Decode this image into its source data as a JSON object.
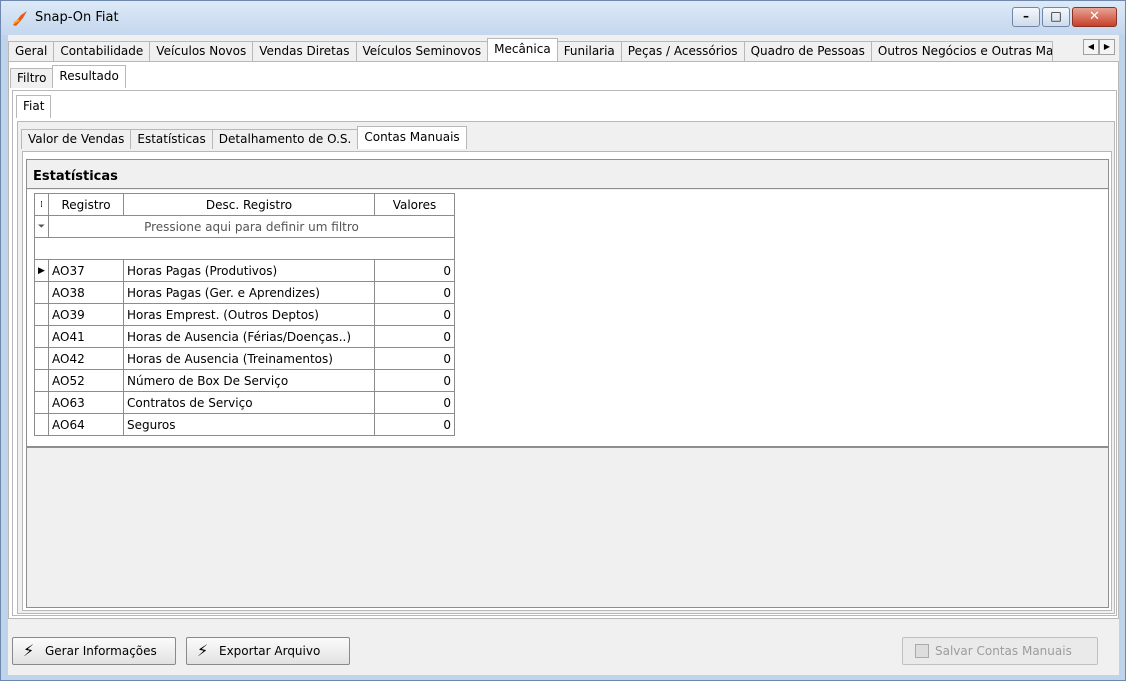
{
  "window": {
    "title": "Snap-On Fiat"
  },
  "main_tabs": [
    "Geral",
    "Contabilidade",
    "Veículos Novos",
    "Vendas Diretas",
    "Veículos Seminovos",
    "Mecânica",
    "Funilaria",
    "Peças / Acessórios",
    "Quadro de Pessoas",
    "Outros Negócios e Outras Mar"
  ],
  "sub_tabs": [
    "Filtro",
    "Resultado"
  ],
  "fiat_tabs": [
    "Fiat"
  ],
  "inner_tabs": [
    "Valor de Vendas",
    "Estatísticas",
    "Detalhamento de O.S.",
    "Contas Manuais"
  ],
  "group": {
    "title": "Estatísticas"
  },
  "grid": {
    "headers": [
      "Registro",
      "Desc. Registro",
      "Valores"
    ],
    "filter_hint": "Pressione aqui para definir um filtro",
    "rows": [
      [
        "AO37",
        "Horas Pagas (Produtivos)",
        "0"
      ],
      [
        "AO38",
        "Horas Pagas (Ger. e Aprendizes)",
        "0"
      ],
      [
        "AO39",
        "Horas Emprest. (Outros Deptos)",
        "0"
      ],
      [
        "AO41",
        "Horas de Ausencia (Férias/Doenças..)",
        "0"
      ],
      [
        "AO42",
        "Horas de Ausencia (Treinamentos)",
        "0"
      ],
      [
        "AO52",
        "Número de Box De Serviço",
        "0"
      ],
      [
        "AO63",
        "Contratos de Serviço",
        "0"
      ],
      [
        "AO64",
        "Seguros",
        "0"
      ]
    ]
  },
  "buttons": {
    "gerar": "Gerar Informações",
    "exportar": "Exportar Arquivo",
    "salvar": "Salvar Contas Manuais"
  },
  "colors": {
    "title_gradient_top": "#dde9f7",
    "close_red": "#c7402a"
  }
}
